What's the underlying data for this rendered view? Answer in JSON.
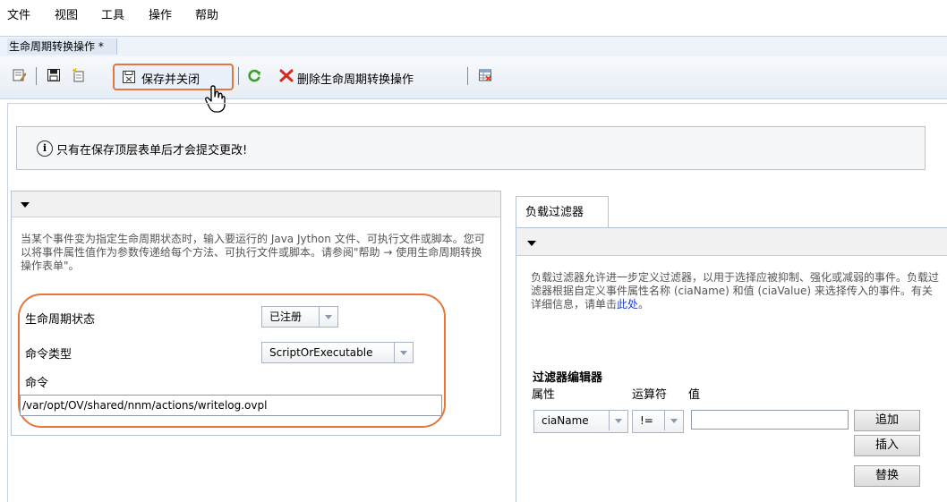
{
  "menu": {
    "items": [
      "文件",
      "视图",
      "工具",
      "操作",
      "帮助"
    ]
  },
  "tab": {
    "title": "生命周期转换操作 *"
  },
  "toolbar": {
    "save_close_label": "保存并关闭",
    "delete_label": "删除生命周期转换操作"
  },
  "info": {
    "message": "只有在保存顶层表单后才会提交更改!"
  },
  "left_panel": {
    "description": "当某个事件变为指定生命周期状态时，输入要运行的 Java Jython 文件、可执行文件或脚本。您可以将事件属性值作为参数传递给每个方法、可执行文件或脚本。请参阅\"帮助 → 使用生命周期转换操作表单\"。",
    "lifecycle_state_label": "生命周期状态",
    "lifecycle_state_value": "已注册",
    "command_type_label": "命令类型",
    "command_type_value": "ScriptOrExecutable",
    "command_label": "命令",
    "command_value": "/var/opt/OV/shared/nnm/actions/writelog.ovpl"
  },
  "right_panel": {
    "tab_label": "负载过滤器",
    "description_text": "负载过滤器允许进一步定义过滤器，以用于选择应被抑制、强化或减弱的事件。负载过滤器根据自定义事件属性名称 (ciaName) 和值 (ciaValue) 来选择传入的事件。有关详细信息，请单击",
    "description_link": "此处",
    "description_end": "。",
    "filter_editor_title": "过滤器编辑器",
    "col_attribute": "属性",
    "col_operator": "运算符",
    "col_value": "值",
    "attribute_value": "ciaName",
    "operator_value": "!=",
    "value_input": "",
    "btn_add": "追加",
    "btn_insert": "插入",
    "btn_replace": "替换"
  },
  "colors": {
    "highlight": "#e8753a",
    "link": "#1a3fd2"
  },
  "icons": [
    "edit-form-icon",
    "save-icon",
    "new-icon",
    "save-close-icon",
    "refresh-icon",
    "delete-icon",
    "table-icon",
    "info-icon",
    "hand-cursor-icon"
  ]
}
